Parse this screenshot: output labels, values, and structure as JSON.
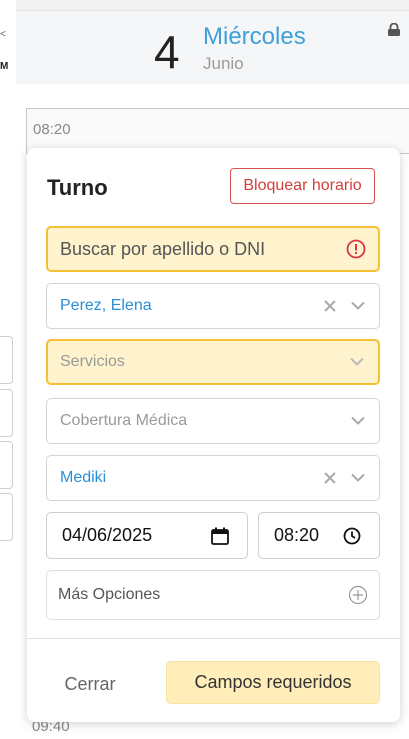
{
  "left_column": {
    "line1": "<",
    "line2": "M"
  },
  "header": {
    "day_number": "4",
    "day_name": "Miércoles",
    "month": "Junio"
  },
  "calendar": {
    "slot_time": "08:20",
    "bottom_time": "09:40"
  },
  "modal": {
    "title": "Turno",
    "block_button": "Bloquear horario",
    "search": {
      "placeholder": "Buscar por apellido o DNI"
    },
    "patient": {
      "value": "Perez, Elena"
    },
    "services": {
      "placeholder": "Servicios"
    },
    "coverage": {
      "placeholder": "Cobertura Médica"
    },
    "plan": {
      "value": "Mediki"
    },
    "date": {
      "value": "04/06/2025"
    },
    "time": {
      "value": "08:20"
    },
    "more_options": "Más Opciones",
    "close_button": "Cerrar",
    "submit_button": "Campos requeridos"
  },
  "colors": {
    "accent_blue": "#2b8fd6",
    "required_border": "#f5c034",
    "required_bg": "#fff3cd",
    "danger": "#d9534f"
  }
}
